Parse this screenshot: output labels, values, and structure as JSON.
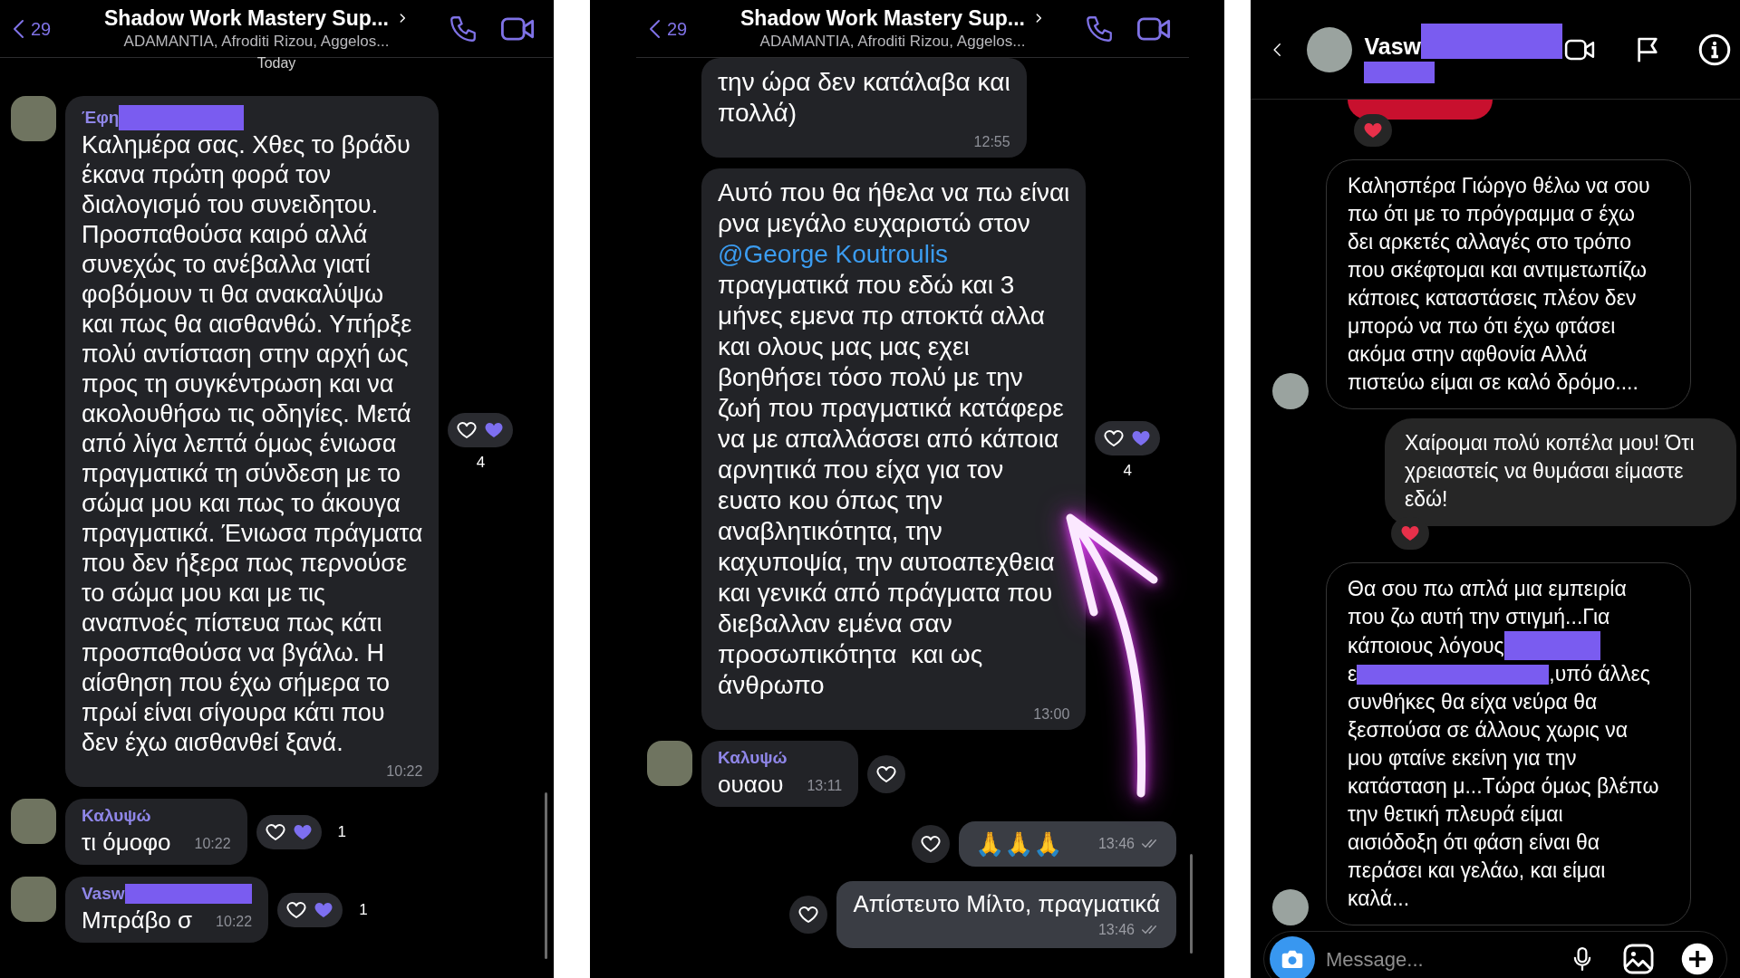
{
  "panels": [
    {
      "kind": "viber",
      "header": {
        "back_count": "29",
        "title": "Shadow Work Mastery Sup...",
        "subtitle": "ADAMANTIA, Afroditi Rizou, Aggelos..."
      },
      "date_label": "Today",
      "messages": [
        {
          "kind": "incoming",
          "show_avatar": true,
          "sender": "Έφη",
          "sender_redacted": true,
          "text": "Καλημέρα σας. Χθες το βράδυ\nέκανα πρώτη φορά τον\nδιαλογισμό του συνειδητου.\nΠροσπαθούσα καιρό αλλά\nσυνεχώς το ανέβαλλα γιατί\nφοβόμουν τι θα ανακαλύψω\nκαι πως θα αισθανθώ. Υπήρξε\nπολύ αντίσταση στην αρχή ως\nπρος τη συγκέντρωση και να\nακολουθήσω τις οδηγίες. Μετά\nαπό λίγα λεπτά όμως ένιωσα\nπραγματικά τη σύνδεση με το\nσώμα μου και πως το άκουγα\nπραγματικά. Ένιωσα πράγματα\nπου δεν ήξερα πως περνούσε\nτο σώμα μου και με τις\nαναπνοές πίστευα πως κάτι\nπροσπαθούσα να βγάλω. Η\nαίσθηση που έχω σήμερα το\nπρωί είναι σίγουρα κάτι που\nδεν έχω αισθανθεί ξανά.",
          "time": "10:22",
          "like_button": true,
          "likes": "4"
        },
        {
          "kind": "incoming",
          "show_avatar": true,
          "sender": "Καλυψώ",
          "sender_redacted": false,
          "text": "τι όμοφο",
          "time": "10:22",
          "like_button": true,
          "likes": "1"
        },
        {
          "kind": "incoming",
          "show_avatar": true,
          "sender": "Vasw",
          "sender_redacted": true,
          "text": "Μπράβο σ",
          "time": "10:22",
          "like_button": true,
          "likes": "1"
        }
      ]
    },
    {
      "kind": "viber",
      "header": {
        "back_count": "29",
        "title": "Shadow Work Mastery Sup...",
        "subtitle": "ADAMANTIA, Afroditi Rizou, Aggelos..."
      },
      "messages": [
        {
          "kind": "incoming",
          "show_avatar": false,
          "text": "την ώρα δεν κατάλαβα και\nπολλά)",
          "time": "12:55",
          "like_button": false
        },
        {
          "kind": "incoming",
          "show_avatar": false,
          "segments": [
            {
              "kind": "text",
              "text": "Αυτό που θα ήθελα να πω είναι\nρνα μεγάλο ευχαριστώ στον\n"
            },
            {
              "kind": "mention",
              "text": "@George Koutroulis"
            },
            {
              "kind": "text",
              "text": "\nπραγματικά που εδώ και 3\nμήνες εμενα πρ αποκτά αλλα\nκαι ολους μας μας εχει\nβοηθήσει τόσο πολύ με την\nζωή που πραγματικά κατάφερε\nνα με απαλλάσσει από κάποια\nαρνητικά που είχα για τον\nευατο κου όπως την\nαναβλητικότητα, την\nκαχυποψία, την αυτοαπεχθεια\nκαι γενικά από πράγματα που\nδιεβαλλαν εμένα σαν\nπροσωπικότητα  και ως\nάνθρωπο"
            }
          ],
          "time": "13:00",
          "like_button": true,
          "likes": "4"
        },
        {
          "kind": "incoming",
          "show_avatar": true,
          "sender": "Καλυψώ",
          "sender_redacted": false,
          "text": "ουαου",
          "time": "13:11",
          "like_button": true
        },
        {
          "kind": "outgoing",
          "text": "🙏🙏🙏",
          "time": "13:46",
          "read": true,
          "like_button": true
        },
        {
          "kind": "outgoing",
          "text": "Απίστευτο Μίλτο, πραγματικά",
          "time": "13:46",
          "read": true,
          "like_button": true
        }
      ],
      "annotation": {
        "kind": "arrow"
      }
    },
    {
      "kind": "instagram",
      "header": {
        "name": "Vasw",
        "name_redacted": true
      },
      "messages": [
        {
          "kind": "sticker",
          "reacted": true
        },
        {
          "kind": "incoming",
          "show_avatar": true,
          "text": "Καλησπέρα Γιώργο θέλω να σου\nπω ότι με το πρόγραμμα σ έχω\nδει αρκετές αλλαγές στο τρόπο\nπου σκέφτομαι και αντιμετωπίζω\nκάποιες καταστάσεις πλέον δεν\nμπορώ να πω ότι έχω φτάσει\nακόμα στην αφθονία Αλλά\nπιστεύω είμαι σε καλό δρόμο....",
          "reacted": false
        },
        {
          "kind": "outgoing",
          "text": "Χαίρομαι πολύ κοπέλα μου! Ότι\nχρειαστείς να θυμάσαι είμαστε\nεδώ!",
          "reacted": true
        },
        {
          "kind": "incoming",
          "show_avatar": true,
          "segments": [
            {
              "kind": "text",
              "text": "Θα σου πω απλά μια εμπειρία\nπου ζω αυτή την στιγμή...Για"
            },
            {
              "kind": "break"
            },
            {
              "kind": "text",
              "text": "κάποιους λόγους"
            },
            {
              "kind": "redaction"
            },
            {
              "kind": "break"
            },
            {
              "kind": "text",
              "text": "ε"
            },
            {
              "kind": "redaction"
            },
            {
              "kind": "text",
              "text": ",υπό άλλες"
            },
            {
              "kind": "break"
            },
            {
              "kind": "text",
              "text": "συνθήκες θα είχα νεύρα θα\nξεσπούσα σε άλλους χωρις να\nμου φταίνε εκείνη για την\nκατάσταση μ...Τώρα όμως βλέπω\nτην θετική πλευρά είμαι\nαισιόδοξη ότι φάση είναι θα\nπεράσει και γελάω, και είμαι\nκαλά..."
            }
          ],
          "reacted": false
        }
      ],
      "composer": {
        "placeholder": "Message..."
      }
    }
  ]
}
